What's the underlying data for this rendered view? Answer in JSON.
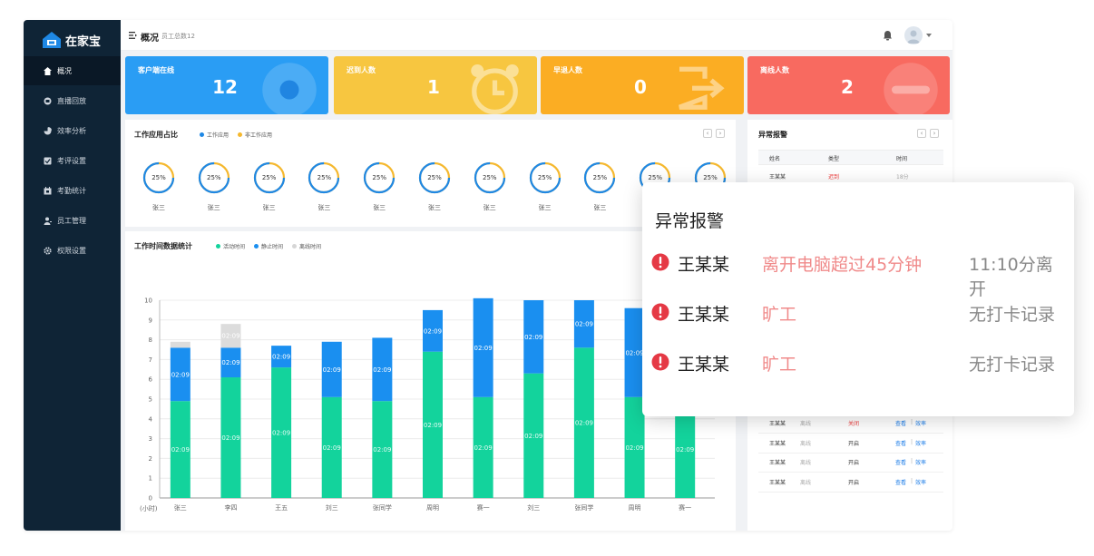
{
  "app": {
    "logo_text": "在家宝"
  },
  "sidebar": {
    "items": [
      {
        "label": "概况",
        "icon": "home-icon",
        "active": true
      },
      {
        "label": "直播回放",
        "icon": "video-icon",
        "active": false
      },
      {
        "label": "效率分析",
        "icon": "pie-chart-icon",
        "active": false
      },
      {
        "label": "考评设置",
        "icon": "checkbox-icon",
        "active": false
      },
      {
        "label": "考勤统计",
        "icon": "calendar-icon",
        "active": false
      },
      {
        "label": "员工管理",
        "icon": "user-icon",
        "active": false
      },
      {
        "label": "权限设置",
        "icon": "gear-icon",
        "active": false
      }
    ]
  },
  "header": {
    "title": "概况",
    "subtitle": "员工总数12"
  },
  "cards": [
    {
      "label": "客户端在线",
      "value": "12",
      "color": "#2a9df4",
      "icon": "circle-icon"
    },
    {
      "label": "迟到人数",
      "value": "1",
      "color": "#f7c640",
      "icon": "alarm-clock-icon"
    },
    {
      "label": "早退人数",
      "value": "0",
      "color": "#fbad23",
      "icon": "exit-icon"
    },
    {
      "label": "离线人数",
      "value": "2",
      "color": "#f86a60",
      "icon": "minus-circle-icon"
    }
  ],
  "usage": {
    "title": "工作应用占比",
    "legend": [
      {
        "label": "工作应用",
        "color": "#1e88e5"
      },
      {
        "label": "非工作应用",
        "color": "#f5b82e"
      }
    ],
    "rings": [
      {
        "name": "张三",
        "percent": 25
      },
      {
        "name": "张三",
        "percent": 25
      },
      {
        "name": "张三",
        "percent": 25
      },
      {
        "name": "张三",
        "percent": 25
      },
      {
        "name": "张三",
        "percent": 25
      },
      {
        "name": "张三",
        "percent": 25
      },
      {
        "name": "张三",
        "percent": 25
      },
      {
        "name": "张三",
        "percent": 25
      },
      {
        "name": "张三",
        "percent": 25
      },
      {
        "name": "",
        "percent": 25
      },
      {
        "name": "",
        "percent": 25
      }
    ],
    "ring_label": "25%"
  },
  "chart_data": {
    "type": "bar",
    "title": "工作时间数据统计",
    "ylabel": "(小时)",
    "ylim": [
      0,
      10
    ],
    "yticks": [
      0,
      1,
      2,
      3,
      4,
      5,
      6,
      7,
      8,
      9,
      10
    ],
    "categories": [
      "张三",
      "李四",
      "王五",
      "刘三",
      "张同学",
      "周明",
      "赛一",
      "刘三",
      "张同学",
      "周明",
      "赛一"
    ],
    "series": [
      {
        "name": "活动时间",
        "color": "#13d39c",
        "values": [
          4.9,
          6.1,
          6.6,
          5.1,
          4.9,
          7.4,
          5.1,
          6.3,
          7.6,
          5.1,
          4.9
        ]
      },
      {
        "name": "静止时间",
        "color": "#1a8ff0",
        "values": [
          2.7,
          1.5,
          1.1,
          2.8,
          3.2,
          2.1,
          5.0,
          3.7,
          2.4,
          4.5,
          2.7
        ]
      },
      {
        "name": "离线时间",
        "color": "#dcdcdc",
        "values": [
          0.3,
          1.2,
          0,
          0,
          0,
          0,
          0,
          0,
          0,
          0,
          0
        ]
      }
    ],
    "bar_label": "02:09",
    "legend": [
      "活动时间",
      "静止时间",
      "离线时间"
    ]
  },
  "alarm_panel": {
    "title": "异常报警",
    "columns": [
      "姓名",
      "类型",
      "时间"
    ],
    "top_rows": [
      {
        "name": "王某某",
        "type": "迟到",
        "time": "18分"
      }
    ],
    "bottom_rows": [
      {
        "name": "王某某",
        "status": "离线",
        "switch": "关闭",
        "view": "查看",
        "eff": "效率"
      },
      {
        "name": "王某某",
        "status": "离线",
        "switch": "开启",
        "view": "查看",
        "eff": "效率"
      },
      {
        "name": "王某某",
        "status": "离线",
        "switch": "开启",
        "view": "查看",
        "eff": "效率"
      },
      {
        "name": "王某某",
        "status": "离线",
        "switch": "开启",
        "view": "查看",
        "eff": "效率"
      }
    ],
    "separator": "|"
  },
  "popup": {
    "title": "异常报警",
    "rows": [
      {
        "name": "王某某",
        "reason": "离开电脑超过45分钟",
        "note": "11:10分离开"
      },
      {
        "name": "王某某",
        "reason": "旷工",
        "note": "无打卡记录"
      },
      {
        "name": "王某某",
        "reason": "旷工",
        "note": "无打卡记录"
      }
    ]
  }
}
